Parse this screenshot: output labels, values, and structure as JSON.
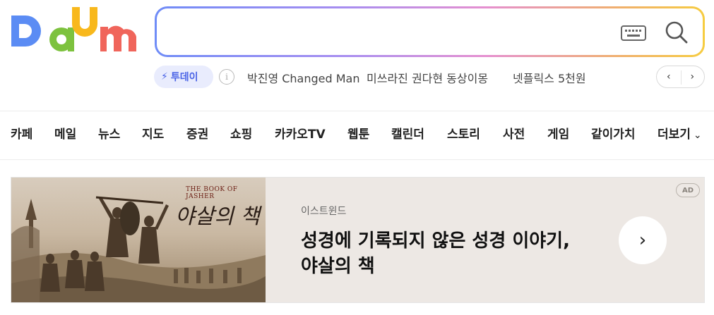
{
  "logo": {
    "text": "Daum",
    "colors": [
      "#5b8cf4",
      "#7dc23e",
      "#f8b81c",
      "#f0655b"
    ]
  },
  "search": {
    "placeholder": "",
    "value": "",
    "keyboard_icon": "keyboard-icon",
    "search_icon": "search-icon"
  },
  "today": {
    "label": "투데이",
    "bolt_icon": "lightning-icon",
    "info_icon": "info-icon",
    "trends": [
      "박진영 Changed Man",
      "미쓰라진 권다현 동상이몽",
      "넷플릭스 5천원"
    ],
    "prev": "‹",
    "next": "›"
  },
  "menu": {
    "items": [
      "카페",
      "메일",
      "뉴스",
      "지도",
      "증권",
      "쇼핑",
      "카카오TV",
      "웹툰",
      "캘린더",
      "스토리",
      "사전",
      "게임",
      "같이가치"
    ],
    "more": "더보기",
    "more_chevron": "⌄"
  },
  "ad": {
    "image_book_title": "THE BOOK OF JASHER",
    "image_script_title": "야살의 책",
    "sponsor": "이스트윈드",
    "headline_line1": "성경에 기록되지 않은 성경 이야기,",
    "headline_line2": "야살의 책",
    "arrow": "›",
    "badge": "AD"
  },
  "colors": {
    "accent_blue": "#4a63e6",
    "today_bg": "#e9ecfd"
  }
}
